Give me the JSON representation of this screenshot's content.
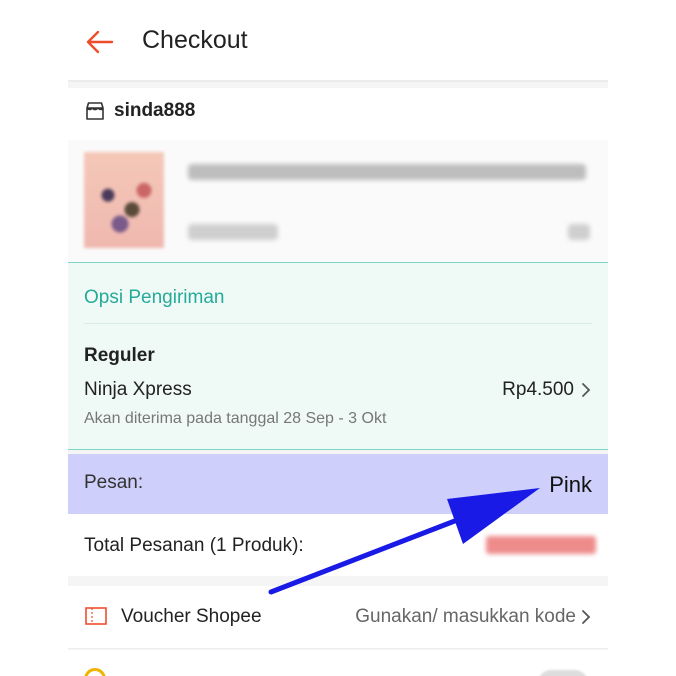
{
  "header": {
    "title": "Checkout",
    "back_icon": "arrow-left-icon",
    "accent": "#ee4d2d"
  },
  "shop": {
    "name": "sinda888",
    "icon": "store-icon"
  },
  "shipping": {
    "title": "Opsi Pengiriman",
    "service": "Reguler",
    "carrier": "Ninja Xpress",
    "price": "Rp4.500",
    "eta": "Akan diterima pada tanggal 28 Sep - 3 Okt",
    "accent": "#26aa99"
  },
  "message": {
    "label": "Pesan:",
    "value": "Pink",
    "highlight": "#cfcffb"
  },
  "total": {
    "label": "Total Pesanan (1 Produk):"
  },
  "voucher": {
    "label": "Voucher Shopee",
    "action": "Gunakan/ masukkan kode",
    "icon": "voucher-ticket-icon"
  },
  "annotation": {
    "color": "#1a1ae6",
    "icon": "pointer-arrow-icon"
  }
}
